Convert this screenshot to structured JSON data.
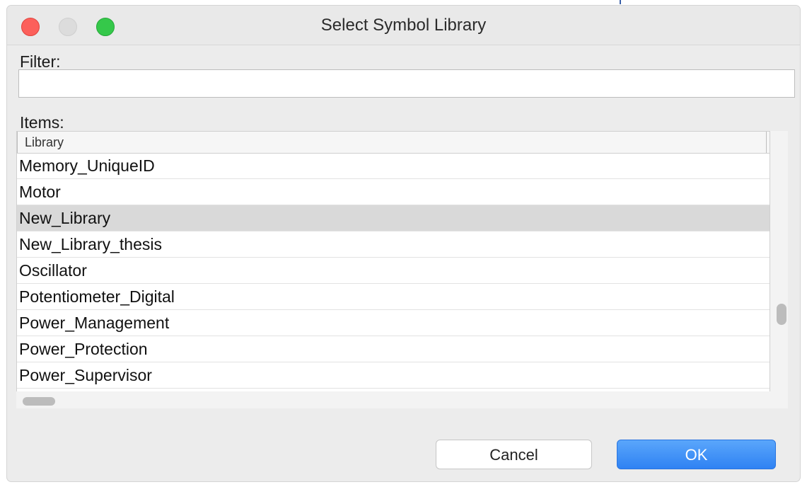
{
  "window": {
    "title": "Select Symbol Library"
  },
  "filter": {
    "label": "Filter:",
    "value": "",
    "placeholder": ""
  },
  "items": {
    "label": "Items:",
    "column_header": "Library",
    "rows": [
      "Memory_UniqueID",
      "Motor",
      "New_Library",
      "New_Library_thesis",
      "Oscillator",
      "Potentiometer_Digital",
      "Power_Management",
      "Power_Protection",
      "Power_Supervisor"
    ],
    "selected_row": "New_Library"
  },
  "buttons": {
    "cancel": "Cancel",
    "ok": "OK"
  },
  "colors": {
    "accent": "#2f82f3",
    "selection": "#d9d9d9",
    "close": "#fc605b",
    "zoom": "#35c84a"
  }
}
